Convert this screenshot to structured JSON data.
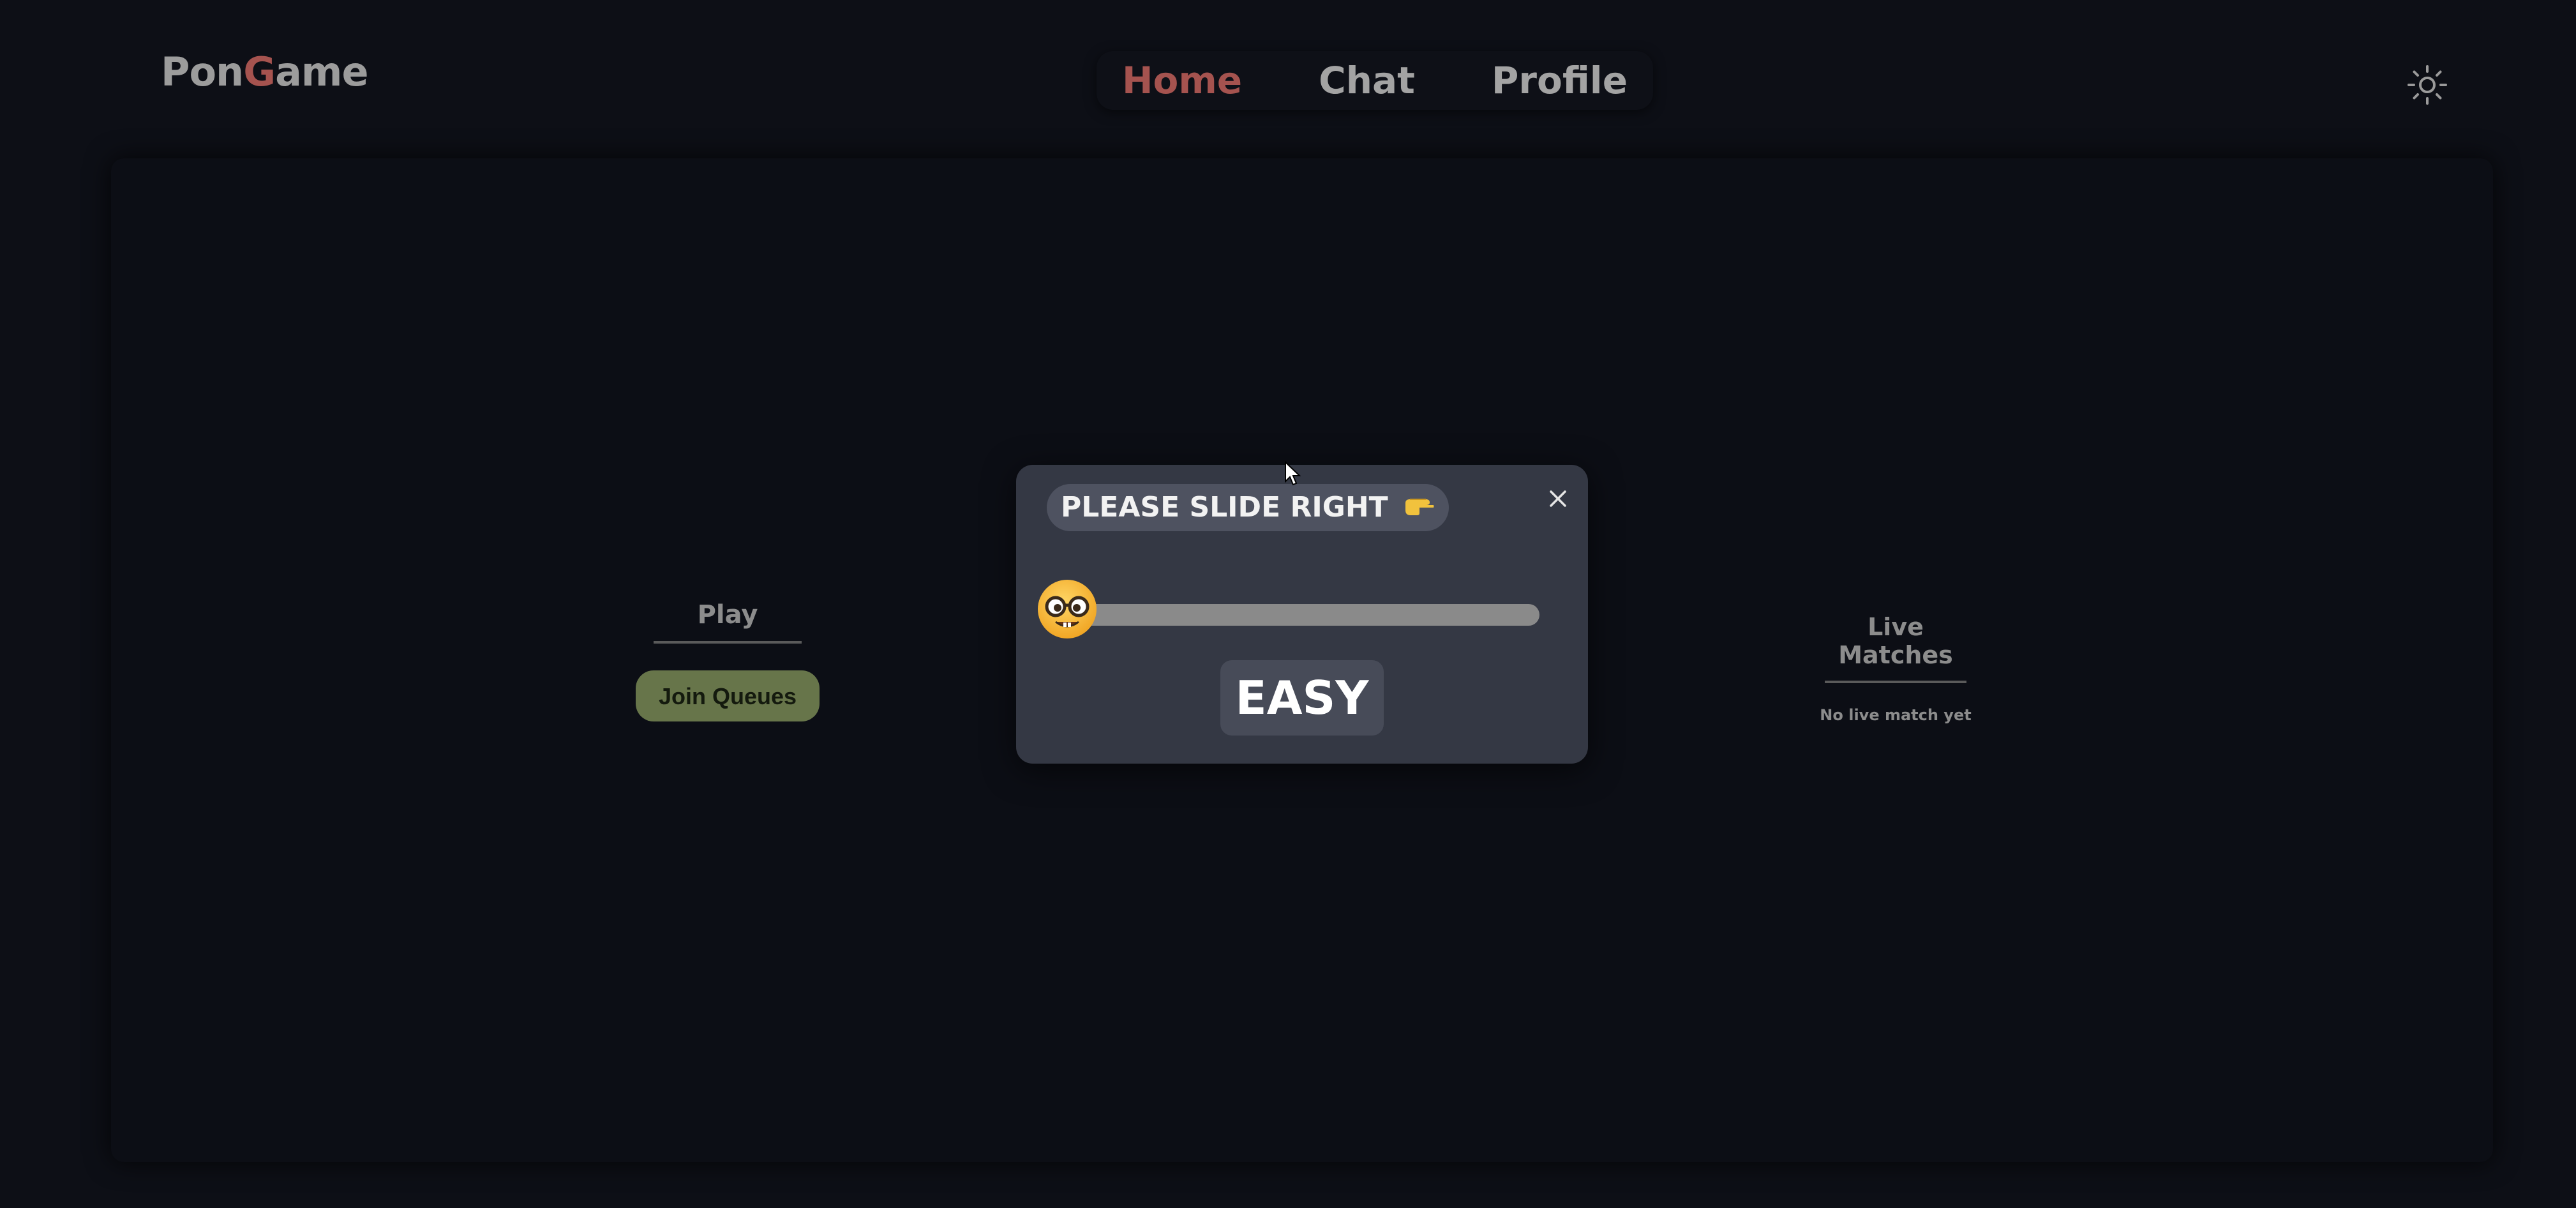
{
  "header": {
    "logo_prefix": "Pon",
    "logo_accent": "G",
    "logo_suffix": "ame",
    "nav": [
      {
        "label": "Home",
        "active": true
      },
      {
        "label": "Chat",
        "active": false
      },
      {
        "label": "Profile",
        "active": false
      }
    ],
    "theme_toggle_icon": "sun-icon"
  },
  "play": {
    "title": "Play",
    "join_label": "Join Queues"
  },
  "live_matches": {
    "title": "Live Matches",
    "empty_text": "No live match yet"
  },
  "modal": {
    "prompt": "PLEASE SLIDE RIGHT",
    "prompt_icon": "pointing-right-hand-icon",
    "close_icon": "close-icon",
    "slider_thumb_icon": "nerd-face-icon",
    "slider_value": 0,
    "difficulty": "EASY"
  },
  "colors": {
    "background": "#0d0f16",
    "accent": "#a5534f",
    "join_button": "#67754a",
    "modal": "#343844"
  }
}
